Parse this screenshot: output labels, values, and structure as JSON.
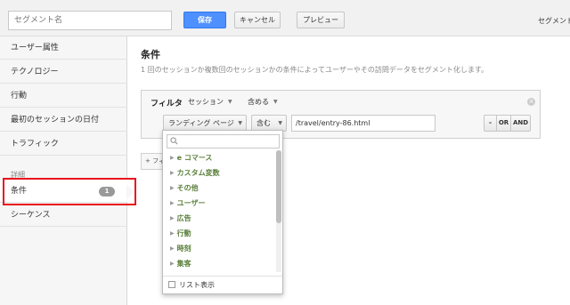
{
  "topbar": {
    "segment_name_placeholder": "セグメント名",
    "save_label": "保存",
    "cancel_label": "キャンセル",
    "preview_label": "プレビュー",
    "right_text": "セグメント"
  },
  "sidebar": {
    "items": [
      {
        "label": "ユーザー属性"
      },
      {
        "label": "テクノロジー"
      },
      {
        "label": "行動"
      },
      {
        "label": "最初のセッションの日付"
      },
      {
        "label": "トラフィック"
      }
    ],
    "section_label": "詳細",
    "advanced_items": [
      {
        "label": "条件",
        "badge": "1"
      },
      {
        "label": "シーケンス"
      }
    ]
  },
  "main": {
    "title": "条件",
    "description": "1 回のセッションか複数回のセッションかの条件によってユーザーやその訪問データをセグメント化します。",
    "filter": {
      "label": "フィルタ",
      "scope": "セッション",
      "mode": "含める",
      "dimension": "ランディング ページ",
      "operator": "含む",
      "value": "/travel/entry-86.html",
      "minus": "–",
      "or": "OR",
      "and": "AND"
    },
    "add_filter_label": "+ フィルタを追加"
  },
  "dropdown": {
    "search_placeholder": "",
    "categories": [
      "e コマース",
      "カスタム変数",
      "その他",
      "ユーザー",
      "広告",
      "行動",
      "時刻",
      "集客"
    ],
    "list_view_label": "リスト表示"
  },
  "colors": {
    "accent": "#4d90fe",
    "category_text": "#5a7f3a",
    "highlight": "#e8141c"
  }
}
